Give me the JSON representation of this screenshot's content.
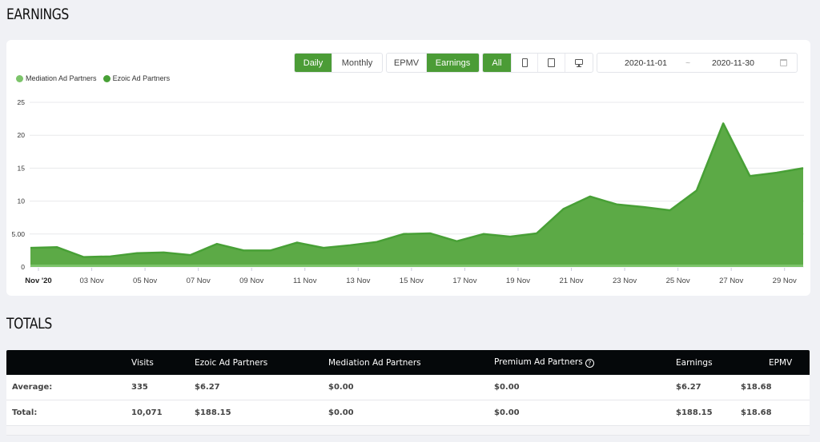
{
  "earnings_section": {
    "title": "EARNINGS"
  },
  "controls": {
    "period": [
      {
        "label": "Daily",
        "active": true
      },
      {
        "label": "Monthly",
        "active": false
      }
    ],
    "metric": [
      {
        "label": "EPMV",
        "active": false
      },
      {
        "label": "Earnings",
        "active": true
      }
    ],
    "device": [
      {
        "label": "All",
        "icon": "",
        "active": true
      },
      {
        "label": "",
        "icon": "phone-icon",
        "active": false
      },
      {
        "label": "",
        "icon": "tablet-icon",
        "active": false
      },
      {
        "label": "",
        "icon": "desktop-icon",
        "active": false
      }
    ],
    "date_range": {
      "start": "2020-11-01",
      "separator": "~",
      "end": "2020-11-30",
      "icon": "calendar-icon"
    }
  },
  "colors": {
    "accent": "#4b9c36",
    "ezoic_fill": "#5caa46",
    "ezoic_line": "#48a036",
    "mediation": "#7cc46a",
    "table_header": "#05080a",
    "background": "#f0f1f5"
  },
  "chart_data": {
    "type": "area",
    "title": "",
    "xlabel": "",
    "ylabel": "",
    "ylim": [
      0,
      25
    ],
    "yticks": [
      {
        "value": 0,
        "label": "0"
      },
      {
        "value": 5,
        "label": "5.00"
      },
      {
        "value": 10,
        "label": "10"
      },
      {
        "value": 15,
        "label": "15"
      },
      {
        "value": 20,
        "label": "20"
      },
      {
        "value": 25,
        "label": "25"
      }
    ],
    "xticks": [
      {
        "day": 1,
        "label": "Nov '20",
        "bold": true
      },
      {
        "day": 3,
        "label": "03 Nov"
      },
      {
        "day": 5,
        "label": "05 Nov"
      },
      {
        "day": 7,
        "label": "07 Nov"
      },
      {
        "day": 9,
        "label": "09 Nov"
      },
      {
        "day": 11,
        "label": "11 Nov"
      },
      {
        "day": 13,
        "label": "13 Nov"
      },
      {
        "day": 15,
        "label": "15 Nov"
      },
      {
        "day": 17,
        "label": "17 Nov"
      },
      {
        "day": 19,
        "label": "19 Nov"
      },
      {
        "day": 21,
        "label": "21 Nov"
      },
      {
        "day": 23,
        "label": "23 Nov"
      },
      {
        "day": 25,
        "label": "25 Nov"
      },
      {
        "day": 27,
        "label": "27 Nov"
      },
      {
        "day": 29,
        "label": "29 Nov"
      }
    ],
    "x": [
      1,
      2,
      3,
      4,
      5,
      6,
      7,
      8,
      9,
      10,
      11,
      12,
      13,
      14,
      15,
      16,
      17,
      18,
      19,
      20,
      21,
      22,
      23,
      24,
      25,
      26,
      27,
      28,
      29,
      30
    ],
    "legend_position": "top-left",
    "grid": true,
    "series": [
      {
        "name": "Mediation Ad Partners",
        "color": "#7cc46a",
        "values": [
          0,
          0,
          0,
          0,
          0,
          0,
          0,
          0,
          0,
          0,
          0,
          0,
          0,
          0,
          0,
          0,
          0,
          0,
          0,
          0,
          0,
          0,
          0,
          0,
          0,
          0,
          0,
          0,
          0,
          0
        ]
      },
      {
        "name": "Ezoic Ad Partners",
        "color": "#48a036",
        "values": [
          2.9,
          3.0,
          1.5,
          1.6,
          2.1,
          2.2,
          1.8,
          3.5,
          2.5,
          2.5,
          3.7,
          2.9,
          3.3,
          3.8,
          5.0,
          5.1,
          3.9,
          5.0,
          4.6,
          5.1,
          8.8,
          10.7,
          9.5,
          9.1,
          8.6,
          11.6,
          21.8,
          13.8,
          14.3,
          15.0
        ]
      }
    ]
  },
  "totals_section": {
    "title": "TOTALS",
    "columns": [
      "",
      "Visits",
      "Ezoic Ad Partners",
      "Mediation Ad Partners",
      "Premium Ad Partners",
      "Earnings",
      "EPMV"
    ],
    "help_icon": "?",
    "rows": [
      [
        "Average:",
        "335",
        "$6.27",
        "$0.00",
        "$0.00",
        "$6.27",
        "$18.68"
      ],
      [
        "Total:",
        "10,071",
        "$188.15",
        "$0.00",
        "$0.00",
        "$188.15",
        "$18.68"
      ]
    ]
  }
}
